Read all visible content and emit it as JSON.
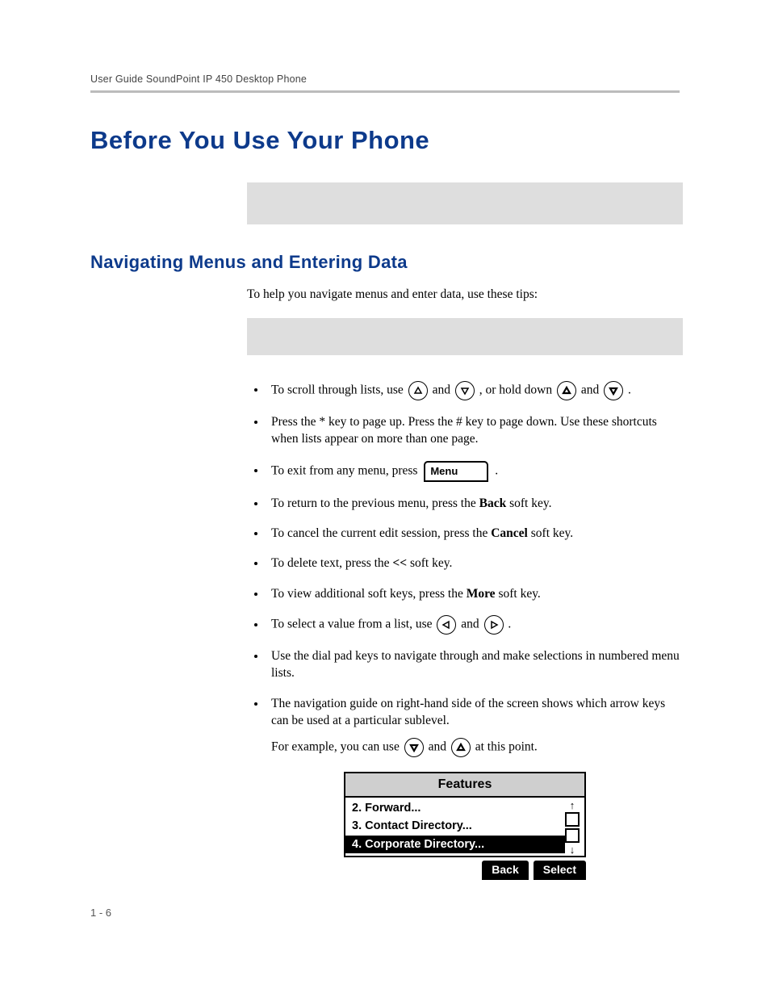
{
  "header": {
    "running": "User Guide SoundPoint IP 450 Desktop Phone"
  },
  "chapter": {
    "title": "Before You Use Your Phone"
  },
  "section": {
    "title": "Navigating Menus and Entering Data"
  },
  "intro": "To help you navigate menus and enter data, use these tips:",
  "tips": {
    "scroll": {
      "a": "To scroll through lists, use ",
      "b": " and ",
      "c": " , or hold down ",
      "d": " and ",
      "e": " ."
    },
    "page": "Press the * key to page up. Press the # key to page down. Use these shortcuts when lists appear on more than one page.",
    "exit": {
      "a": "To exit from any menu, press ",
      "btn": "Menu",
      "b": " ."
    },
    "back": {
      "a": "To return to the previous menu, press the ",
      "key": "Back",
      "b": " soft key."
    },
    "cancel": {
      "a": "To cancel the current edit session, press the ",
      "key": "Cancel",
      "b": " soft key."
    },
    "delete": {
      "a": "To delete text, press the ",
      "key": "<<",
      "b": " soft key."
    },
    "more": {
      "a": "To view additional soft keys, press the ",
      "key": "More",
      "b": " soft key."
    },
    "select": {
      "a": "To select a value from a list, use ",
      "b": " and ",
      "c": " ."
    },
    "dialpad": "Use the dial pad keys to navigate through and make selections in numbered menu lists.",
    "navguide": {
      "line1": "The navigation guide on right-hand side of the screen shows which arrow keys can be used at a particular sublevel.",
      "line2a": "For example, you can use ",
      "line2b": " and ",
      "line2c": " at this point."
    }
  },
  "lcd": {
    "title": "Features",
    "rows": [
      "2. Forward...",
      "3. Contact Directory...",
      "4. Corporate Directory..."
    ],
    "soft": {
      "back": "Back",
      "select": "Select"
    }
  },
  "footer": {
    "page": "1 - 6"
  }
}
